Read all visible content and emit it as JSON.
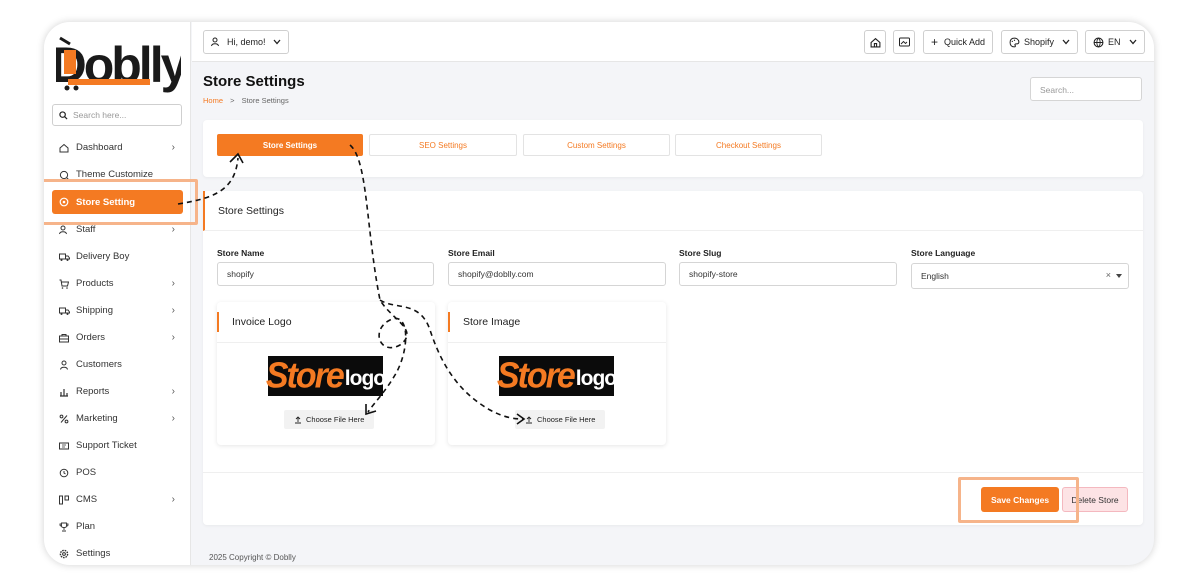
{
  "app": {
    "name": "Doblly"
  },
  "sidebar": {
    "search_placeholder": "Search here...",
    "items": [
      {
        "label": "Dashboard",
        "icon": "home-icon",
        "chevron": true
      },
      {
        "label": "Theme Customize",
        "icon": "theme-icon",
        "chevron": false
      },
      {
        "label": "Store Setting",
        "icon": "store-icon",
        "chevron": false,
        "active": true
      },
      {
        "label": "Staff",
        "icon": "users-icon",
        "chevron": true
      },
      {
        "label": "Delivery Boy",
        "icon": "truck-icon",
        "chevron": false
      },
      {
        "label": "Products",
        "icon": "cart-icon",
        "chevron": true
      },
      {
        "label": "Shipping",
        "icon": "shipping-icon",
        "chevron": true
      },
      {
        "label": "Orders",
        "icon": "orders-icon",
        "chevron": true
      },
      {
        "label": "Customers",
        "icon": "user-icon",
        "chevron": false
      },
      {
        "label": "Reports",
        "icon": "chart-icon",
        "chevron": true
      },
      {
        "label": "Marketing",
        "icon": "marketing-icon",
        "chevron": true
      },
      {
        "label": "Support Ticket",
        "icon": "ticket-icon",
        "chevron": false
      },
      {
        "label": "POS",
        "icon": "pos-icon",
        "chevron": false
      },
      {
        "label": "CMS",
        "icon": "cms-icon",
        "chevron": true
      },
      {
        "label": "Plan",
        "icon": "trophy-icon",
        "chevron": false
      },
      {
        "label": "Settings",
        "icon": "gear-icon",
        "chevron": false
      }
    ]
  },
  "topbar": {
    "greeting": "Hi, demo!",
    "quick_add": "Quick Add",
    "store_switcher": "Shopify",
    "language": "EN"
  },
  "header": {
    "title": "Store Settings",
    "breadcrumb_home": "Home",
    "breadcrumb_sep": ">",
    "breadcrumb_current": "Store Settings",
    "search_placeholder": "Search..."
  },
  "tabs": [
    {
      "label": "Store Settings",
      "active": true
    },
    {
      "label": "SEO Settings",
      "active": false
    },
    {
      "label": "Custom Settings",
      "active": false
    },
    {
      "label": "Checkout Settings",
      "active": false
    }
  ],
  "form": {
    "section_title": "Store Settings",
    "store_name_label": "Store Name",
    "store_name_value": "shopify",
    "store_email_label": "Store Email",
    "store_email_value": "shopify@doblly.com",
    "store_slug_label": "Store Slug",
    "store_slug_value": "shopify-store",
    "store_language_label": "Store Language",
    "store_language_value": "English",
    "clear_glyph": "×",
    "invoice_logo_title": "Invoice Logo",
    "store_image_title": "Store Image",
    "logo_word_a": "Store",
    "logo_word_b": "logo",
    "choose_file": "Choose File Here",
    "save_label": "Save Changes",
    "delete_label": "Delete Store"
  },
  "footer": {
    "text": "2025 Copyright © Doblly"
  },
  "colors": {
    "accent": "#f47a22",
    "highlight": "#f6b48a",
    "danger_bg": "#fde3e5"
  }
}
